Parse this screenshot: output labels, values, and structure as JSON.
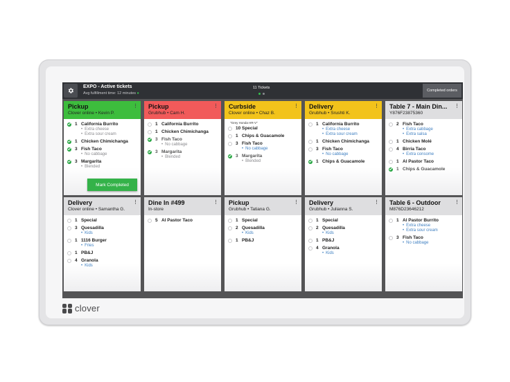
{
  "header": {
    "title": "EXPO - Active tickets",
    "subtitle": "Avg fulfillment time: 12 minutes",
    "ticket_count": "11 Tickets",
    "completed_button": "Completed orders"
  },
  "brand": {
    "name": "clover"
  },
  "colors": {
    "pickup_green": "#3dbd3d",
    "pickup_red": "#f15a5a",
    "curbside_yellow": "#f2c31b",
    "table_gray": "#dedee0",
    "complete_green": "#34b249",
    "topbar": "#2f3135"
  },
  "mark_completed_label": "Mark Completed",
  "tickets": [
    {
      "color": "green",
      "title": "Pickup",
      "source": "Clover online",
      "name": "Kevin P.",
      "items": [
        {
          "qty": "1",
          "name": "California Burrito",
          "done": true,
          "mods": [
            {
              "text": "Extra cheese",
              "style": "gray"
            },
            {
              "text": "Extra sour cream",
              "style": "gray"
            }
          ]
        },
        {
          "qty": "1",
          "name": "Chicken Chimichanga",
          "done": true,
          "mods": []
        },
        {
          "qty": "3",
          "name": "Fish Taco",
          "done": true,
          "mods": [
            {
              "text": "No cabbage",
              "style": "gray"
            }
          ]
        },
        {
          "qty": "3",
          "name": "Margarita",
          "done": true,
          "mods": [
            {
              "text": "Blended",
              "style": "gray"
            }
          ]
        }
      ]
    },
    {
      "color": "red",
      "title": "Pickup",
      "source": "Grubhub",
      "name": "Cam H.",
      "items": [
        {
          "qty": "1",
          "name": "California Burrito",
          "done": false,
          "mods": []
        },
        {
          "qty": "1",
          "name": "Chicken Chimichanga",
          "done": false,
          "mods": []
        },
        {
          "qty": "3",
          "name": "Fish Taco",
          "done": true,
          "faded": true,
          "mods": [
            {
              "text": "No cabbage",
              "style": "gray"
            }
          ]
        },
        {
          "qty": "3",
          "name": "Margarita",
          "done": true,
          "faded": true,
          "mods": [
            {
              "text": "Blended",
              "style": "gray"
            }
          ]
        }
      ]
    },
    {
      "color": "yellow",
      "title": "Curbside",
      "source": "Clover online",
      "name": "Chaz B.",
      "note": "\"Grey Honda HR-V\"",
      "items": [
        {
          "qty": "10",
          "name": "Special",
          "done": false,
          "mods": []
        },
        {
          "qty": "1",
          "name": "Chips & Guacamole",
          "done": false,
          "mods": []
        },
        {
          "qty": "3",
          "name": "Fish Taco",
          "done": false,
          "mods": [
            {
              "text": "No cabbage",
              "style": "blue"
            }
          ]
        },
        {
          "qty": "3",
          "name": "Margarita",
          "done": true,
          "faded": true,
          "mods": [
            {
              "text": "Blended",
              "style": "gray"
            }
          ]
        }
      ]
    },
    {
      "color": "yellow",
      "title": "Delivery",
      "source": "Grubhub",
      "name": "Srushti K.",
      "items": [
        {
          "qty": "1",
          "name": "California Burrito",
          "done": false,
          "mods": [
            {
              "text": "Extra cheese",
              "style": "blue"
            },
            {
              "text": "Extra sour cream",
              "style": "blue"
            }
          ]
        },
        {
          "qty": "1",
          "name": "Chicken Chimichanga",
          "done": false,
          "mods": []
        },
        {
          "qty": "3",
          "name": "Fish Taco",
          "done": false,
          "mods": [
            {
              "text": "No cabbage",
              "style": "blue"
            }
          ]
        },
        {
          "qty": "1",
          "name": "Chips & Guacamole",
          "done": true,
          "mods": []
        }
      ]
    },
    {
      "color": "gray",
      "title": "Table 7 - Main Din...",
      "source": "Y876F23875360",
      "name": "",
      "items": [
        {
          "qty": "2",
          "name": "Fish Taco",
          "done": false,
          "mods": [
            {
              "text": "Extra cabbage",
              "style": "blue"
            },
            {
              "text": "Extra salsa",
              "style": "blue"
            }
          ]
        },
        {
          "qty": "1",
          "name": "Chicken Molé",
          "done": false,
          "mods": []
        },
        {
          "qty": "4",
          "name": "Birria Taco",
          "done": false,
          "mods": [
            {
              "text": "Extra consome",
              "style": "blue"
            }
          ]
        },
        {
          "qty": "1",
          "name": "Al Pastor Taco",
          "done": false,
          "mods": []
        },
        {
          "qty": "1",
          "name": "Chips & Guacamole",
          "done": true,
          "faded": true,
          "mods": []
        }
      ]
    },
    {
      "color": "gray",
      "title": "Delivery",
      "source": "Clover online",
      "name": "Samantha G.",
      "items": [
        {
          "qty": "1",
          "name": "Special",
          "done": false,
          "mods": []
        },
        {
          "qty": "3",
          "name": "Quesadilla",
          "done": false,
          "mods": [
            {
              "text": "Kids",
              "style": "blue"
            }
          ]
        },
        {
          "qty": "1",
          "name": "1116 Burger",
          "done": false,
          "mods": [
            {
              "text": "Fries",
              "style": "blue"
            }
          ]
        },
        {
          "qty": "1",
          "name": "PB&J",
          "done": false,
          "mods": []
        },
        {
          "qty": "4",
          "name": "Granola",
          "done": false,
          "mods": [
            {
              "text": "Kids",
              "style": "blue"
            }
          ]
        }
      ]
    },
    {
      "color": "gray",
      "title": "Dine In #499",
      "source": "In-store",
      "name": "",
      "items": [
        {
          "qty": "5",
          "name": "Al Pastor Taco",
          "done": false,
          "mods": []
        }
      ]
    },
    {
      "color": "gray",
      "title": "Pickup",
      "source": "Grubhub",
      "name": "Tatiana G.",
      "items": [
        {
          "qty": "1",
          "name": "Special",
          "done": false,
          "mods": []
        },
        {
          "qty": "2",
          "name": "Quesadilla",
          "done": false,
          "mods": [
            {
              "text": "Kids",
              "style": "blue"
            }
          ]
        },
        {
          "qty": "1",
          "name": "PB&J",
          "done": false,
          "mods": []
        }
      ]
    },
    {
      "color": "gray",
      "title": "Delivery",
      "source": "Grubhub",
      "name": "Julianna S.",
      "items": [
        {
          "qty": "1",
          "name": "Special",
          "done": false,
          "mods": []
        },
        {
          "qty": "2",
          "name": "Quesadilla",
          "done": false,
          "mods": [
            {
              "text": "Kids",
              "style": "blue"
            }
          ]
        },
        {
          "qty": "1",
          "name": "PB&J",
          "done": false,
          "mods": []
        },
        {
          "qty": "4",
          "name": "Granola",
          "done": false,
          "mods": [
            {
              "text": "Kids",
              "style": "blue"
            }
          ]
        }
      ]
    },
    {
      "color": "gray",
      "title": "Table 6 - Outdoor",
      "source": "M876D23646212",
      "name": "",
      "items": [
        {
          "qty": "1",
          "name": "Al Pastor Burrito",
          "done": false,
          "mods": [
            {
              "text": "Extra cheese",
              "style": "blue"
            },
            {
              "text": "Extra sour cream",
              "style": "blue"
            }
          ]
        },
        {
          "qty": "3",
          "name": "Fish Taco",
          "done": false,
          "mods": [
            {
              "text": "No cabbage",
              "style": "blue"
            }
          ]
        }
      ]
    }
  ]
}
